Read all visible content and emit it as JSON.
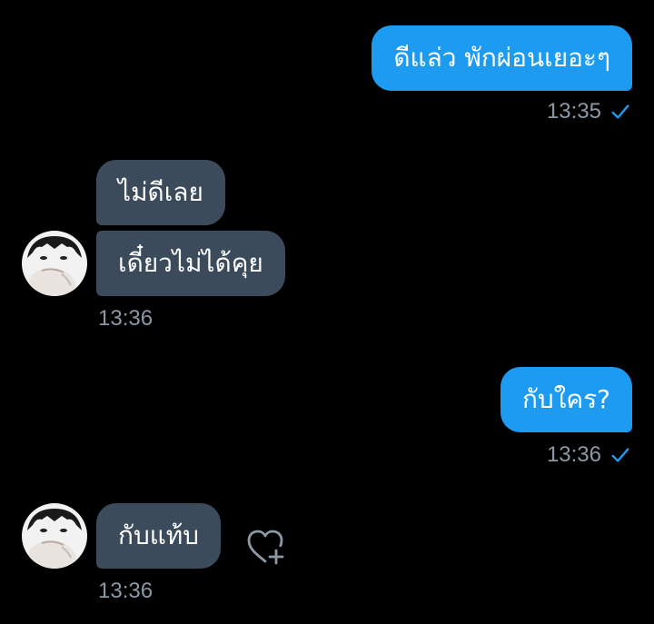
{
  "messages": [
    {
      "text": "ดีแล่ว พักผ่อนเยอะๆ",
      "direction": "outgoing"
    },
    {
      "text": "ไม่ดีเลย",
      "direction": "incoming"
    },
    {
      "text": "เดี๋ยวไม่ได้คุย",
      "direction": "incoming"
    },
    {
      "text": "กับใคร?",
      "direction": "outgoing"
    },
    {
      "text": "กับแท้บ",
      "direction": "incoming"
    }
  ],
  "timestamps": {
    "t1": "13:35",
    "t2": "13:36",
    "t3": "13:36",
    "t4": "13:36"
  },
  "icons": {
    "read_receipt": "check-icon",
    "reaction": "heart-plus-icon"
  },
  "colors": {
    "background": "#000000",
    "outgoing_bubble": "#1d9bf0",
    "incoming_bubble": "#3b4b5b",
    "timestamp": "#8b98a5",
    "check": "#1d9bf0"
  }
}
